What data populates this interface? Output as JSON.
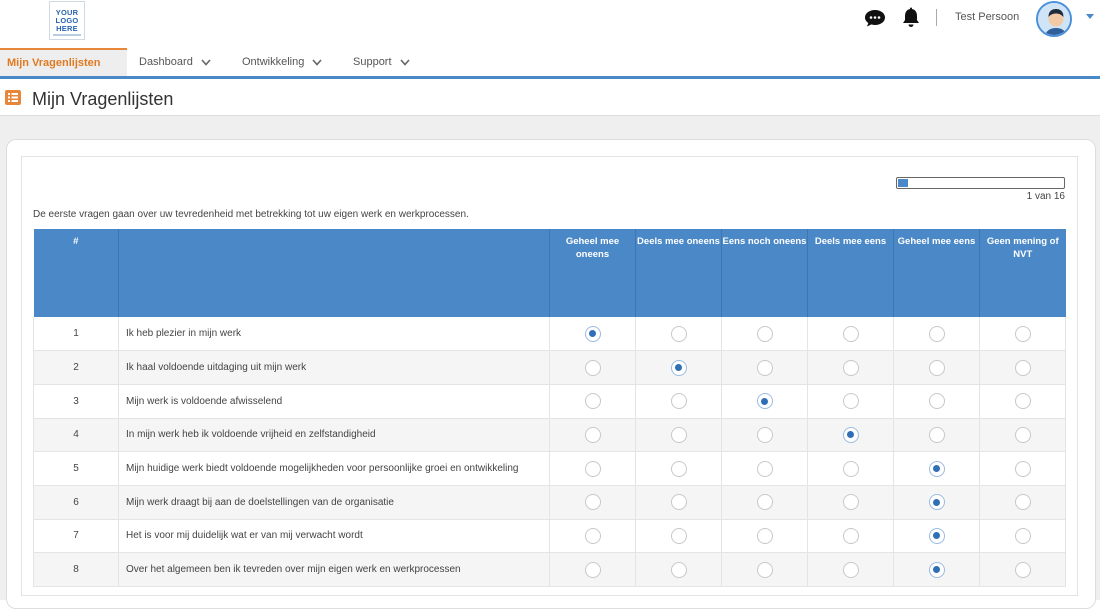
{
  "header": {
    "logo_text": "YOUR\nLOGO\nHERE",
    "user_name": "Test Persoon"
  },
  "nav": {
    "items": [
      {
        "label": "Mijn Vragenlijsten",
        "active": true
      },
      {
        "label": "Dashboard"
      },
      {
        "label": "Ontwikkeling"
      },
      {
        "label": "Support"
      }
    ]
  },
  "page": {
    "title": "Mijn Vragenlijsten"
  },
  "survey": {
    "progress": {
      "current": 1,
      "total": 16,
      "label": "1 van 16",
      "fraction": 0.0625
    },
    "intro": "De eerste vragen gaan over uw tevredenheid met betrekking tot uw eigen werk en werkprocessen.",
    "columns": {
      "number": "#",
      "question": "",
      "options": [
        "Geheel mee oneens",
        "Deels mee oneens",
        "Eens noch oneens",
        "Deels mee eens",
        "Geheel mee eens",
        "Geen mening of NVT"
      ]
    },
    "rows": [
      {
        "n": "1",
        "text": "Ik heb plezier in mijn werk",
        "selected": 0
      },
      {
        "n": "2",
        "text": "Ik haal voldoende uitdaging uit mijn werk",
        "selected": 1
      },
      {
        "n": "3",
        "text": "Mijn werk is voldoende afwisselend",
        "selected": 2
      },
      {
        "n": "4",
        "text": "In mijn werk heb ik voldoende vrijheid en zelfstandigheid",
        "selected": 3
      },
      {
        "n": "5",
        "text": "Mijn huidige werk biedt voldoende mogelijkheden voor persoonlijke groei en ontwikkeling",
        "selected": 4
      },
      {
        "n": "6",
        "text": "Mijn werk draagt bij aan de doelstellingen van de organisatie",
        "selected": 4
      },
      {
        "n": "7",
        "text": "Het is voor mij duidelijk wat er van mij verwacht wordt",
        "selected": 4
      },
      {
        "n": "8",
        "text": "Over het algemeen ben ik tevreden over mijn eigen werk en werkprocessen",
        "selected": 4
      }
    ]
  },
  "colors": {
    "accent_blue": "#4a88c7",
    "active_orange": "#e8873a",
    "radio_selected": "#2f6fb5"
  }
}
